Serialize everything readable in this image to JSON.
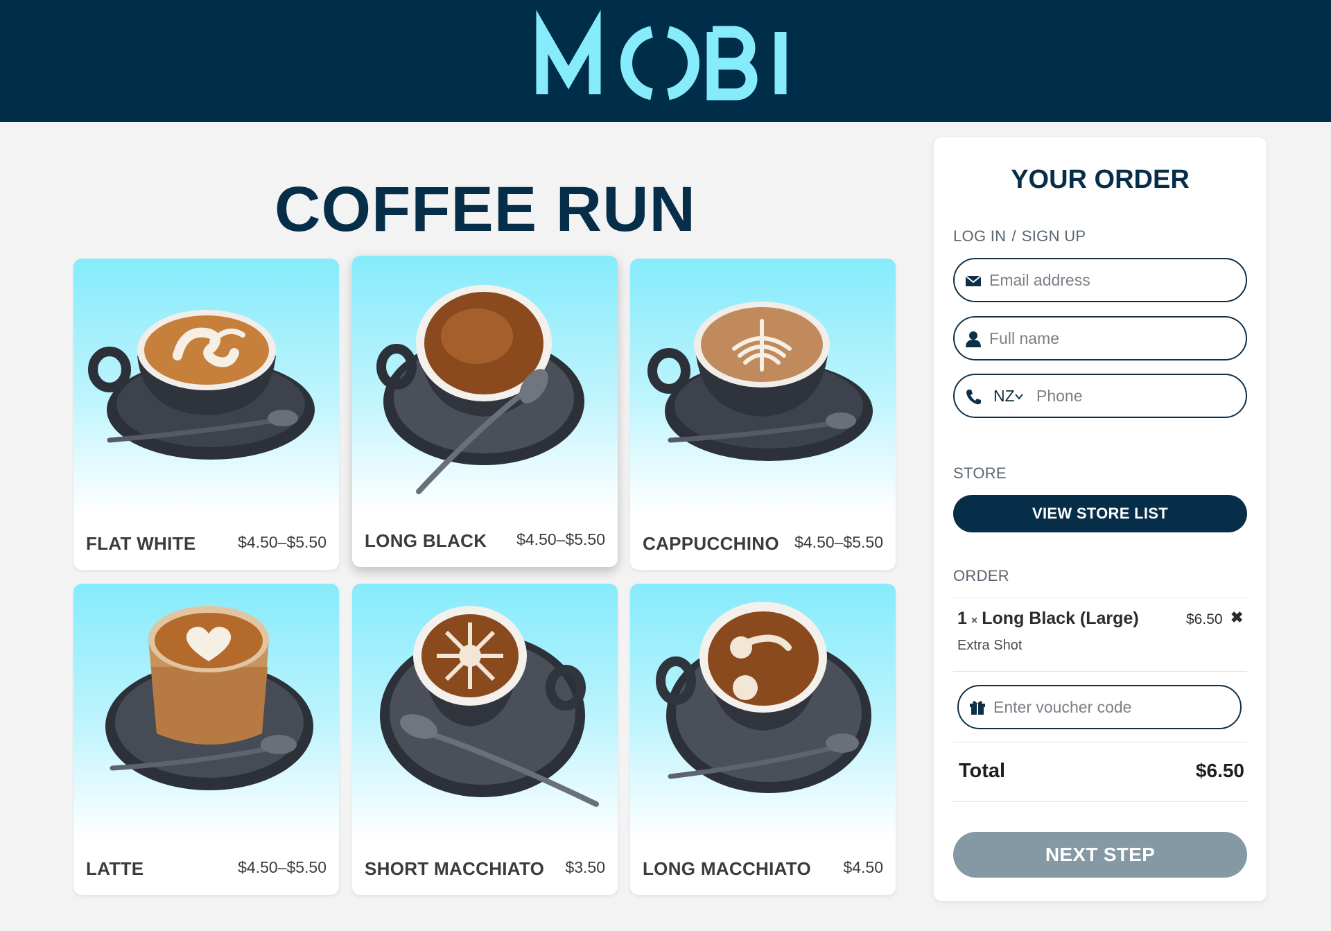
{
  "brand": {
    "name": "MOBI",
    "header_color": "#002e48",
    "logo_color": "#86ebfb"
  },
  "page": {
    "title": "COFFEE RUN"
  },
  "products": [
    {
      "name": "FLAT WHITE",
      "price": "$4.50–$5.50",
      "art": "swan"
    },
    {
      "name": "LONG BLACK",
      "price": "$4.50–$5.50",
      "art": "crema"
    },
    {
      "name": "CAPPUCCHINO",
      "price": "$4.50–$5.50",
      "art": "rosetta"
    },
    {
      "name": "LATTE",
      "price": "$4.50–$5.50",
      "art": "heart"
    },
    {
      "name": "SHORT MACCHIATO",
      "price": "$3.50",
      "art": "flower"
    },
    {
      "name": "LONG MACCHIATO",
      "price": "$4.50",
      "art": "dots"
    }
  ],
  "order": {
    "title": "YOUR ORDER",
    "login_label": "LOG IN",
    "login_sep": "/",
    "signup_label": "SIGN UP",
    "email_placeholder": "Email address",
    "name_placeholder": "Full name",
    "phone_country": "NZ",
    "phone_placeholder": "Phone",
    "store_label": "STORE",
    "store_button": "VIEW STORE LIST",
    "order_label": "ORDER",
    "item": {
      "qty": "1",
      "times": "×",
      "name": "Long Black (Large)",
      "option": "Extra Shot",
      "price": "$6.50",
      "remove": "✖"
    },
    "voucher_placeholder": "Enter voucher code",
    "total_label": "Total",
    "total_value": "$6.50",
    "next_button": "NEXT STEP"
  },
  "icons": [
    "mail-icon",
    "user-icon",
    "phone-icon",
    "chevron-down-icon",
    "gift-icon",
    "close-icon"
  ]
}
